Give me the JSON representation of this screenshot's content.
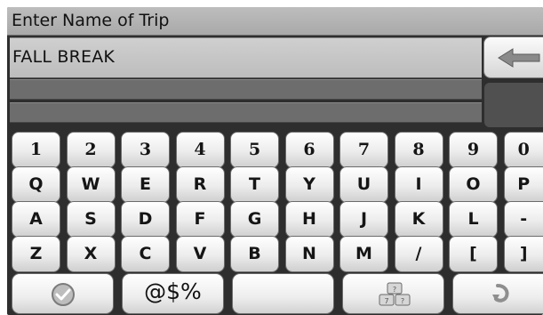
{
  "title": "Enter Name of Trip",
  "entry": {
    "value": "FALL BREAK"
  },
  "keyboard": {
    "rows": [
      [
        "1",
        "2",
        "3",
        "4",
        "5",
        "6",
        "7",
        "8",
        "9",
        "0"
      ],
      [
        "Q",
        "W",
        "E",
        "R",
        "T",
        "Y",
        "U",
        "I",
        "O",
        "P"
      ],
      [
        "A",
        "S",
        "D",
        "F",
        "G",
        "H",
        "J",
        "K",
        "L",
        "-"
      ],
      [
        "Z",
        "X",
        "C",
        "V",
        "B",
        "N",
        "M",
        "/",
        "[",
        "]"
      ]
    ],
    "bottom_row": {
      "confirm_icon": "checkmark-circle-icon",
      "symbols_label": "@$%",
      "space_label": "",
      "layout_icon": "keyboard-layout-icon",
      "undo_icon": "curved-arrow-icon"
    }
  },
  "icons": {
    "backspace": "back-arrow-icon"
  },
  "colors": {
    "background": "#2e2e2e",
    "title_bar": "#b3b3b3",
    "entry_field": "#c6c6c6",
    "key_face": "#eeeeee"
  }
}
